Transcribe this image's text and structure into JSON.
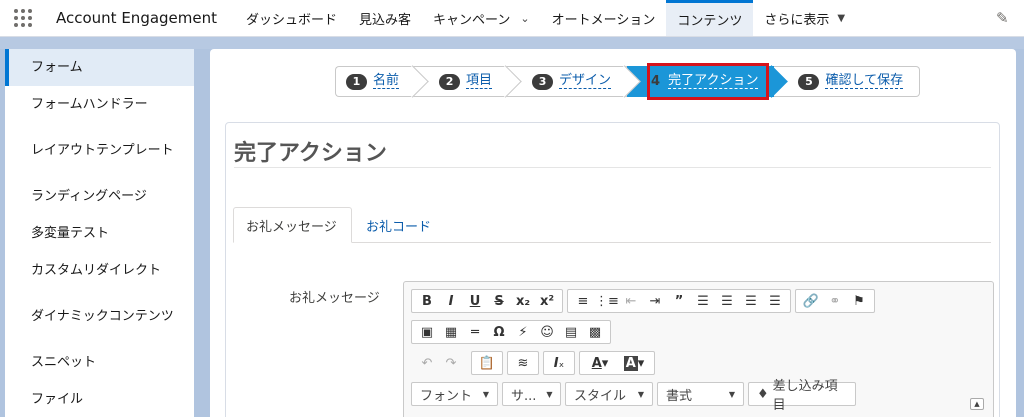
{
  "app": {
    "name": "Account Engagement"
  },
  "nav": {
    "items": [
      {
        "label": "ダッシュボード"
      },
      {
        "label": "見込み客"
      },
      {
        "label": "キャンペーン"
      },
      {
        "label": "オートメーション"
      },
      {
        "label": "コンテンツ"
      },
      {
        "label": "さらに表示"
      }
    ],
    "active_index": 4
  },
  "sidebar": {
    "items": [
      {
        "label": "フォーム"
      },
      {
        "label": "フォームハンドラー"
      },
      {
        "label": "レイアウトテンプレート"
      },
      {
        "label": "ランディングページ"
      },
      {
        "label": "多変量テスト"
      },
      {
        "label": "カスタムリダイレクト"
      },
      {
        "label": "ダイナミックコンテンツ"
      },
      {
        "label": "スニペット"
      },
      {
        "label": "ファイル"
      }
    ],
    "active_index": 0
  },
  "wizard": {
    "steps": [
      {
        "num": "1",
        "label": "名前"
      },
      {
        "num": "2",
        "label": "項目"
      },
      {
        "num": "3",
        "label": "デザイン"
      },
      {
        "num": "4",
        "label": "完了アクション"
      },
      {
        "num": "5",
        "label": "確認して保存"
      }
    ],
    "current_index": 3
  },
  "section": {
    "title": "完了アクション"
  },
  "tabs": [
    {
      "label": "お礼メッセージ"
    },
    {
      "label": "お礼コード"
    }
  ],
  "field": {
    "label": "お礼メッセージ"
  },
  "editor": {
    "dropdowns": [
      {
        "label": "フォント"
      },
      {
        "label": "サ..."
      },
      {
        "label": "スタイル"
      },
      {
        "label": "書式"
      }
    ],
    "merge_button": "差し込み項目"
  },
  "colors": {
    "accent": "#0176d3",
    "wizard_current": "#1b96d8",
    "highlight": "#d6131b",
    "link": "#0b5cab"
  }
}
